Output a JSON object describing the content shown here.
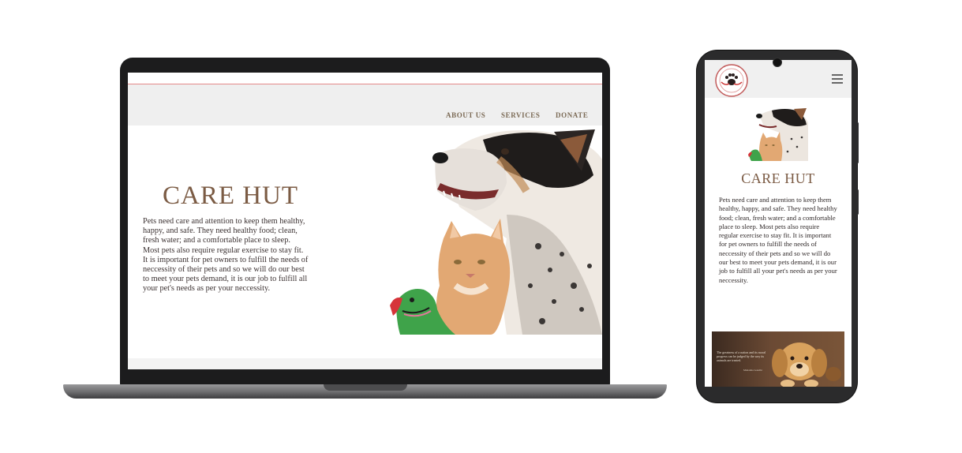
{
  "laptop_site": {
    "nav": {
      "about_label": "ABOUT US",
      "services_label": "SERVICES",
      "donate_label": "DONATE"
    },
    "hero": {
      "title": "CARE HUT",
      "body": "Pets need care and attention to keep them healthy, happy, and safe. They need healthy food; clean, fresh water; and a comfortable place to sleep. Most pets also require regular exercise to stay fit. It is important for pet owners to fulfill the needs of neccessity of their pets and so we will do our best to meet your pets demand, it is our job to fulfill all your pet's needs as per your neccessity."
    }
  },
  "phone_site": {
    "title": "CARE HUT",
    "body": "Pets need care and attention to keep them healthy, happy, and safe. They need healthy food; clean, fresh water; and a comfortable place to sleep. Most pets also require regular exercise to stay fit. It is important for pet owners to fulfill the needs of neccessity of their pets and so we will do our best to meet your pets demand, it is our job to fulfill all your pet's needs as per your neccessity.",
    "banner_quote": "The greatness of a nation and its moral progress can be judged by the way its animals are treated.",
    "banner_author": "Mahatma Gandhi"
  },
  "icons": {
    "logo": "care-hut-paw-logo-icon",
    "menu": "hamburger-menu-icon",
    "hero": "dog-cat-parrot-image",
    "banner": "puppy-banner-image"
  },
  "colors": {
    "brand_brown": "#7b5b44",
    "nav_text": "#7b6a55",
    "accent_line": "#e58a8a"
  }
}
